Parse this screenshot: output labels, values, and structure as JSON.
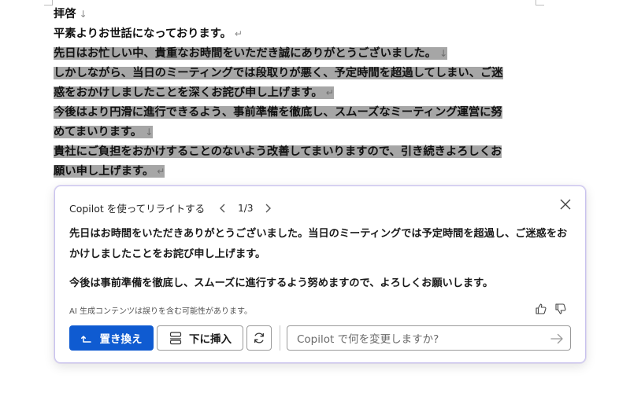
{
  "document": {
    "lines": [
      {
        "text": "拝啓",
        "mark": "↓",
        "highlight": false
      },
      {
        "text": "平素よりお世話になっております。",
        "mark": "↵",
        "highlight": false
      },
      {
        "text": "先日はお忙しい中、貴重なお時間をいただき誠にありがとうございました。",
        "mark": "↓",
        "highlight": true
      },
      {
        "text": "しかしながら、当日のミーティングでは段取りが悪く、予定時間を超過してしまい、ご迷",
        "mark": "",
        "highlight": true
      },
      {
        "text": "惑をおかけしましたことを深くお詫び申し上げます。",
        "mark": "↵",
        "highlight": true
      },
      {
        "text": "今後はより円滑に進行できるよう、事前準備を徹底し、スムーズなミーティング運営に努",
        "mark": "",
        "highlight": true
      },
      {
        "text": "めてまいります。",
        "mark": "↓",
        "highlight": true
      },
      {
        "text": "貴社にご負担をおかけすることのないよう改善してまいりますので、引き続きよろしくお",
        "mark": "",
        "highlight": true
      },
      {
        "text": "願い申し上げます。",
        "mark": "↵",
        "highlight": true
      }
    ]
  },
  "copilot": {
    "title": "Copilot を使ってリライトする",
    "counter": "1/3",
    "paragraph1": "先日はお時間をいただきありがとうございました。当日のミーティングでは予定時間を超過し、ご迷惑をおかけしましたことをお詫び申し上げます。",
    "paragraph2": "今後は事前準備を徹底し、スムーズに進行するよう努めますので、よろしくお願いします。",
    "disclaimer": "AI 生成コンテンツは誤りを含む可能性があります。",
    "replace_label": "置き換え",
    "insert_label": "下に挿入",
    "prompt_placeholder": "Copilot で何を変更しますか?",
    "accent_color": "#0f5bd1",
    "icons": {
      "close": "close-icon",
      "prev": "chevron-left-icon",
      "next": "chevron-right-icon",
      "thumbs_up": "thumbs-up-icon",
      "thumbs_down": "thumbs-down-icon",
      "replace": "replace-arrow-icon",
      "insert": "insert-below-icon",
      "regenerate": "regenerate-icon",
      "send": "send-arrow-icon"
    }
  }
}
